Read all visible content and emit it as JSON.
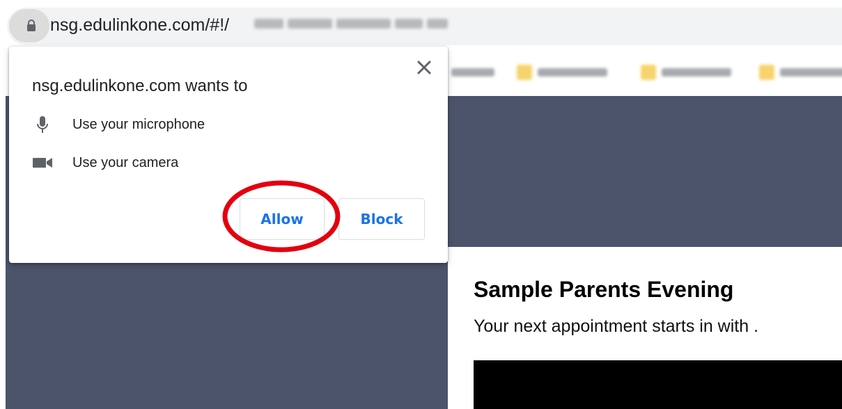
{
  "browser": {
    "url_visible": "nsg.edulinkone.com/#!/",
    "url_obscured": "[blurred path]",
    "bookmarks": [
      {
        "label": "[blurred]"
      },
      {
        "label": "[blurred]"
      },
      {
        "label": "[blurred]"
      },
      {
        "label": "[blurred]"
      }
    ]
  },
  "permission_popup": {
    "title": "nsg.edulinkone.com wants to",
    "close_symbol": "✕",
    "permissions": [
      {
        "icon": "microphone-icon",
        "label": "Use your microphone"
      },
      {
        "icon": "camera-icon",
        "label": "Use your camera"
      }
    ],
    "allow_label": "Allow",
    "block_label": "Block",
    "highlight_color": "#e3000f"
  },
  "page": {
    "title": "Sample Parents Evening",
    "subtitle": "Your next appointment starts in with ."
  },
  "colors": {
    "page_background": "#4b546b",
    "button_text": "#1a73e8",
    "omnibox": "#f1f3f4"
  }
}
